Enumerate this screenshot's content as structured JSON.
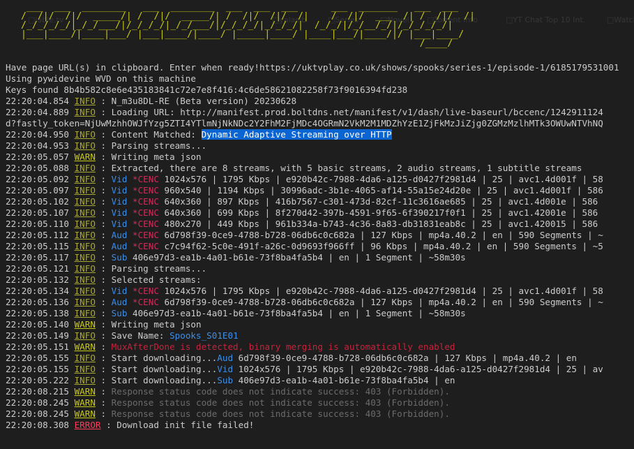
{
  "background_tabs": [
    {
      "label": "jable.tv",
      "offset": 40
    },
    {
      "label": "yalasib",
      "offset": 390
    },
    {
      "label": "Series",
      "offset": 470
    },
    {
      "label": "Novel",
      "offset": 545
    },
    {
      "label": "Torrent Info",
      "offset": 612
    },
    {
      "label": "YT Chat Top 10 Int.",
      "offset": 725
    },
    {
      "label": "Watch",
      "offset": 870
    }
  ],
  "logo_ascii": " ___  ___  ________   ___  ________  ___  ___  ___      ___  _______   ___  ___\n/  /|/  /|/  _____/| /  /|/  _____/| /  /|/  /|/  /|    /  /|/  ___  /| /  /|/  /|\n/_/_/_/_/|_/_/___/|/_/_/_/|_/_/___/|/_/_/_/|_/_/_/|  /_/_/|/_/__/_/|/_/_/_/_/|\n|___|____/|____|___/ |___|____/|____/ |_____|____/ |____|___/|____/|/ |___|____/\n                                                                        /____/",
  "colors": {
    "background": "#1e1e1e",
    "text": "#cccccc",
    "info": "#a8a832",
    "warn": "#c8c816",
    "error": "#ff3c5a",
    "dim": "#6b6b6b",
    "cenc_red": "#d7285a",
    "stream_blue": "#3b8eea",
    "selection": "#0a64d2"
  },
  "lines": [
    [
      {
        "t": "Have page URL(s) in clipboard. Enter when ready!https://uktvplay.co.uk/shows/spooks/series-1/episode-1/6185179531001",
        "s": "plain"
      }
    ],
    [
      {
        "t": "Using pywidevine WVD on this machine",
        "s": "plain"
      }
    ],
    [
      {
        "t": "Keys found 8b4b582c8e6e435183841c72e7e8f416:4c6de58621082258f73f9016394fd238",
        "s": "plain"
      }
    ],
    [
      {
        "t": "22:20:04.854 ",
        "s": "plain"
      },
      {
        "t": "INFO",
        "s": "info"
      },
      {
        "t": " : N_m3u8DL-RE (Beta version) 20230628",
        "s": "plain"
      }
    ],
    [
      {
        "t": "22:20:04.889 ",
        "s": "plain"
      },
      {
        "t": "INFO",
        "s": "info"
      },
      {
        "t": " : Loading URL: http://manifest.prod.boltdns.net/manifest/v1/dash/live-baseurl/bccenc/1242911124",
        "s": "plain"
      }
    ],
    [
      {
        "t": "d?fastly_token=NjUwMzhhOWJfYzg5ZTI4YTlmNjNkNDc2Y2FhM2FjMDc4OGRmN2VkM2M1MDZhYzE1ZjFkMzJiZjg0ZGMzMzlhMTk3OWUwNTVhNQ",
        "s": "plain"
      }
    ],
    [
      {
        "t": "22:20:04.950 ",
        "s": "plain"
      },
      {
        "t": "INFO",
        "s": "info"
      },
      {
        "t": " : Content Matched: ",
        "s": "plain"
      },
      {
        "t": "Dynamic Adaptive Streaming over HTTP",
        "s": "sel"
      }
    ],
    [
      {
        "t": "22:20:04.953 ",
        "s": "plain"
      },
      {
        "t": "INFO",
        "s": "info"
      },
      {
        "t": " : Parsing streams...",
        "s": "plain"
      }
    ],
    [
      {
        "t": "22:20:05.057 ",
        "s": "plain"
      },
      {
        "t": "WARN",
        "s": "warn"
      },
      {
        "t": " : Writing meta json",
        "s": "plain"
      }
    ],
    [
      {
        "t": "22:20:05.088 ",
        "s": "plain"
      },
      {
        "t": "INFO",
        "s": "info"
      },
      {
        "t": " : Extracted, there are 8 streams, with 5 basic streams, 2 audio streams, 1 subtitle streams",
        "s": "plain"
      }
    ],
    [
      {
        "t": "22:20:05.092 ",
        "s": "plain"
      },
      {
        "t": "INFO",
        "s": "info"
      },
      {
        "t": " : ",
        "s": "plain"
      },
      {
        "t": "Vid",
        "s": "blue"
      },
      {
        "t": " ",
        "s": "plain"
      },
      {
        "t": "*CENC",
        "s": "red"
      },
      {
        "t": " 1024x576 | 1795 Kbps | e920b42c-7988-4da6-a125-d0427f2981d4 | 25 | avc1.4d001f | 58",
        "s": "plain"
      }
    ],
    [
      {
        "t": "22:20:05.097 ",
        "s": "plain"
      },
      {
        "t": "INFO",
        "s": "info"
      },
      {
        "t": " : ",
        "s": "plain"
      },
      {
        "t": "Vid",
        "s": "blue"
      },
      {
        "t": " ",
        "s": "plain"
      },
      {
        "t": "*CENC",
        "s": "red"
      },
      {
        "t": " 960x540 | 1194 Kbps | 30996adc-3b1e-4065-af14-55a15e24d20e | 25 | avc1.4d001f | 586",
        "s": "plain"
      }
    ],
    [
      {
        "t": "22:20:05.102 ",
        "s": "plain"
      },
      {
        "t": "INFO",
        "s": "info"
      },
      {
        "t": " : ",
        "s": "plain"
      },
      {
        "t": "Vid",
        "s": "blue"
      },
      {
        "t": " ",
        "s": "plain"
      },
      {
        "t": "*CENC",
        "s": "red"
      },
      {
        "t": " 640x360 | 897 Kbps | 416b7567-c301-473d-82cf-11c3616ae685 | 25 | avc1.4d001e | 586",
        "s": "plain"
      }
    ],
    [
      {
        "t": "22:20:05.107 ",
        "s": "plain"
      },
      {
        "t": "INFO",
        "s": "info"
      },
      {
        "t": " : ",
        "s": "plain"
      },
      {
        "t": "Vid",
        "s": "blue"
      },
      {
        "t": " ",
        "s": "plain"
      },
      {
        "t": "*CENC",
        "s": "red"
      },
      {
        "t": " 640x360 | 699 Kbps | 8f270d42-397b-4591-9f65-6f390217f0f1 | 25 | avc1.42001e | 586",
        "s": "plain"
      }
    ],
    [
      {
        "t": "22:20:05.110 ",
        "s": "plain"
      },
      {
        "t": "INFO",
        "s": "info"
      },
      {
        "t": " : ",
        "s": "plain"
      },
      {
        "t": "Vid",
        "s": "blue"
      },
      {
        "t": " ",
        "s": "plain"
      },
      {
        "t": "*CENC",
        "s": "red"
      },
      {
        "t": " 480x270 | 449 Kbps | 961b334a-b743-4c36-8a83-db31831eab8c | 25 | avc1.420015 | 586",
        "s": "plain"
      }
    ],
    [
      {
        "t": "22:20:05.112 ",
        "s": "plain"
      },
      {
        "t": "INFO",
        "s": "info"
      },
      {
        "t": " : ",
        "s": "plain"
      },
      {
        "t": "Aud",
        "s": "blue"
      },
      {
        "t": " ",
        "s": "plain"
      },
      {
        "t": "*CENC",
        "s": "red"
      },
      {
        "t": " 6d798f39-0ce9-4788-b728-06db6c0c682a | 127 Kbps | mp4a.40.2 | en | 590 Segments | ~",
        "s": "plain"
      }
    ],
    [
      {
        "t": "22:20:05.115 ",
        "s": "plain"
      },
      {
        "t": "INFO",
        "s": "info"
      },
      {
        "t": " : ",
        "s": "plain"
      },
      {
        "t": "Aud",
        "s": "blue"
      },
      {
        "t": " ",
        "s": "plain"
      },
      {
        "t": "*CENC",
        "s": "red"
      },
      {
        "t": " c7c94f62-5c0e-491f-a26c-0d9693f966ff | 96 Kbps | mp4a.40.2 | en | 590 Segments | ~5",
        "s": "plain"
      }
    ],
    [
      {
        "t": "22:20:05.117 ",
        "s": "plain"
      },
      {
        "t": "INFO",
        "s": "info"
      },
      {
        "t": " : ",
        "s": "plain"
      },
      {
        "t": "Sub",
        "s": "blue"
      },
      {
        "t": " 406e97d3-ea1b-4a01-b61e-73f8ba4fa5b4 | en | 1 Segment | ~58m30s",
        "s": "plain"
      }
    ],
    [
      {
        "t": "22:20:05.121 ",
        "s": "plain"
      },
      {
        "t": "INFO",
        "s": "info"
      },
      {
        "t": " : Parsing streams...",
        "s": "plain"
      }
    ],
    [
      {
        "t": "22:20:05.132 ",
        "s": "plain"
      },
      {
        "t": "INFO",
        "s": "info"
      },
      {
        "t": " : Selected streams:",
        "s": "plain"
      }
    ],
    [
      {
        "t": "22:20:05.134 ",
        "s": "plain"
      },
      {
        "t": "INFO",
        "s": "info"
      },
      {
        "t": " : ",
        "s": "plain"
      },
      {
        "t": "Vid",
        "s": "blue"
      },
      {
        "t": " ",
        "s": "plain"
      },
      {
        "t": "*CENC",
        "s": "red"
      },
      {
        "t": " 1024x576 | 1795 Kbps | e920b42c-7988-4da6-a125-d0427f2981d4 | 25 | avc1.4d001f | 58",
        "s": "plain"
      }
    ],
    [
      {
        "t": "22:20:05.136 ",
        "s": "plain"
      },
      {
        "t": "INFO",
        "s": "info"
      },
      {
        "t": " : ",
        "s": "plain"
      },
      {
        "t": "Aud",
        "s": "blue"
      },
      {
        "t": " ",
        "s": "plain"
      },
      {
        "t": "*CENC",
        "s": "red"
      },
      {
        "t": " 6d798f39-0ce9-4788-b728-06db6c0c682a | 127 Kbps | mp4a.40.2 | en | 590 Segments | ~",
        "s": "plain"
      }
    ],
    [
      {
        "t": "22:20:05.138 ",
        "s": "plain"
      },
      {
        "t": "INFO",
        "s": "info"
      },
      {
        "t": " : ",
        "s": "plain"
      },
      {
        "t": "Sub",
        "s": "blue"
      },
      {
        "t": " 406e97d3-ea1b-4a01-b61e-73f8ba4fa5b4 | en | 1 Segment | ~58m30s",
        "s": "plain"
      }
    ],
    [
      {
        "t": "22:20:05.140 ",
        "s": "plain"
      },
      {
        "t": "WARN",
        "s": "warn"
      },
      {
        "t": " : Writing meta json",
        "s": "plain"
      }
    ],
    [
      {
        "t": "22:20:05.149 ",
        "s": "plain"
      },
      {
        "t": "INFO",
        "s": "info"
      },
      {
        "t": " : Save Name: ",
        "s": "plain"
      },
      {
        "t": "Spooks_S01E01",
        "s": "blue"
      }
    ],
    [
      {
        "t": "22:20:05.151 ",
        "s": "plain"
      },
      {
        "t": "WARN",
        "s": "warn"
      },
      {
        "t": " : ",
        "s": "plain"
      },
      {
        "t": "MuxAfterDone is detected, binary merging is automatically enabled",
        "s": "redmsg"
      }
    ],
    [
      {
        "t": "22:20:05.155 ",
        "s": "plain"
      },
      {
        "t": "INFO",
        "s": "info"
      },
      {
        "t": " : Start downloading...",
        "s": "plain"
      },
      {
        "t": "Aud",
        "s": "blue"
      },
      {
        "t": " 6d798f39-0ce9-4788-b728-06db6c0c682a | 127 Kbps | mp4a.40.2 | en",
        "s": "plain"
      }
    ],
    [
      {
        "t": "22:20:05.155 ",
        "s": "plain"
      },
      {
        "t": "INFO",
        "s": "info"
      },
      {
        "t": " : Start downloading...",
        "s": "plain"
      },
      {
        "t": "Vid",
        "s": "blue"
      },
      {
        "t": " 1024x576 | 1795 Kbps | e920b42c-7988-4da6-a125-d0427f2981d4 | 25 | av",
        "s": "plain"
      }
    ],
    [
      {
        "t": "22:20:05.222 ",
        "s": "plain"
      },
      {
        "t": "INFO",
        "s": "info"
      },
      {
        "t": " : Start downloading...",
        "s": "plain"
      },
      {
        "t": "Sub",
        "s": "blue"
      },
      {
        "t": " 406e97d3-ea1b-4a01-b61e-73f8ba4fa5b4 | en",
        "s": "plain"
      }
    ],
    [
      {
        "t": "22:20:08.215 ",
        "s": "plain"
      },
      {
        "t": "WARN",
        "s": "warn"
      },
      {
        "t": " : ",
        "s": "plain"
      },
      {
        "t": "Response status code does not indicate success: 403 (Forbidden).",
        "s": "dim"
      }
    ],
    [
      {
        "t": "22:20:08.245 ",
        "s": "plain"
      },
      {
        "t": "WARN",
        "s": "warn"
      },
      {
        "t": " : ",
        "s": "plain"
      },
      {
        "t": "Response status code does not indicate success: 403 (Forbidden).",
        "s": "dim"
      }
    ],
    [
      {
        "t": "22:20:08.245 ",
        "s": "plain"
      },
      {
        "t": "WARN",
        "s": "warn"
      },
      {
        "t": " : ",
        "s": "plain"
      },
      {
        "t": "Response status code does not indicate success: 403 (Forbidden).",
        "s": "dim"
      }
    ],
    [
      {
        "t": "22:20:08.308 ",
        "s": "plain"
      },
      {
        "t": "ERROR",
        "s": "error"
      },
      {
        "t": " : Download init file failed!",
        "s": "plain"
      }
    ]
  ]
}
